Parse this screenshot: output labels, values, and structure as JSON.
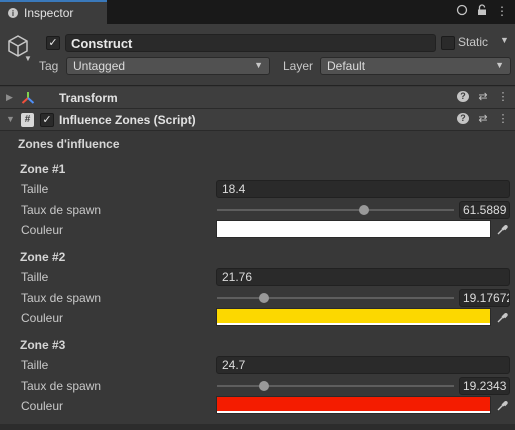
{
  "tab": {
    "label": "Inspector"
  },
  "object": {
    "name": "Construct",
    "active": true,
    "static_label": "Static",
    "static": false
  },
  "tag": {
    "label": "Tag",
    "value": "Untagged"
  },
  "layer": {
    "label": "Layer",
    "value": "Default"
  },
  "components": {
    "transform": {
      "title": "Transform"
    },
    "script": {
      "title": "Influence Zones (Script)",
      "enabled": true
    }
  },
  "zones_label": "Zones d'influence",
  "labels": {
    "size": "Taille",
    "spawn": "Taux de spawn",
    "color": "Couleur"
  },
  "zones": [
    {
      "title": "Zone #1",
      "size": "18.4",
      "spawn_rate": "61.5889",
      "spawn_fraction": 0.62,
      "color": "#ffffff"
    },
    {
      "title": "Zone #2",
      "size": "21.76",
      "spawn_rate": "19.17672",
      "spawn_fraction": 0.2,
      "color": "#fcd800"
    },
    {
      "title": "Zone #3",
      "size": "24.7",
      "spawn_rate": "19.2343",
      "spawn_fraction": 0.2,
      "color": "#f41c00"
    }
  ]
}
